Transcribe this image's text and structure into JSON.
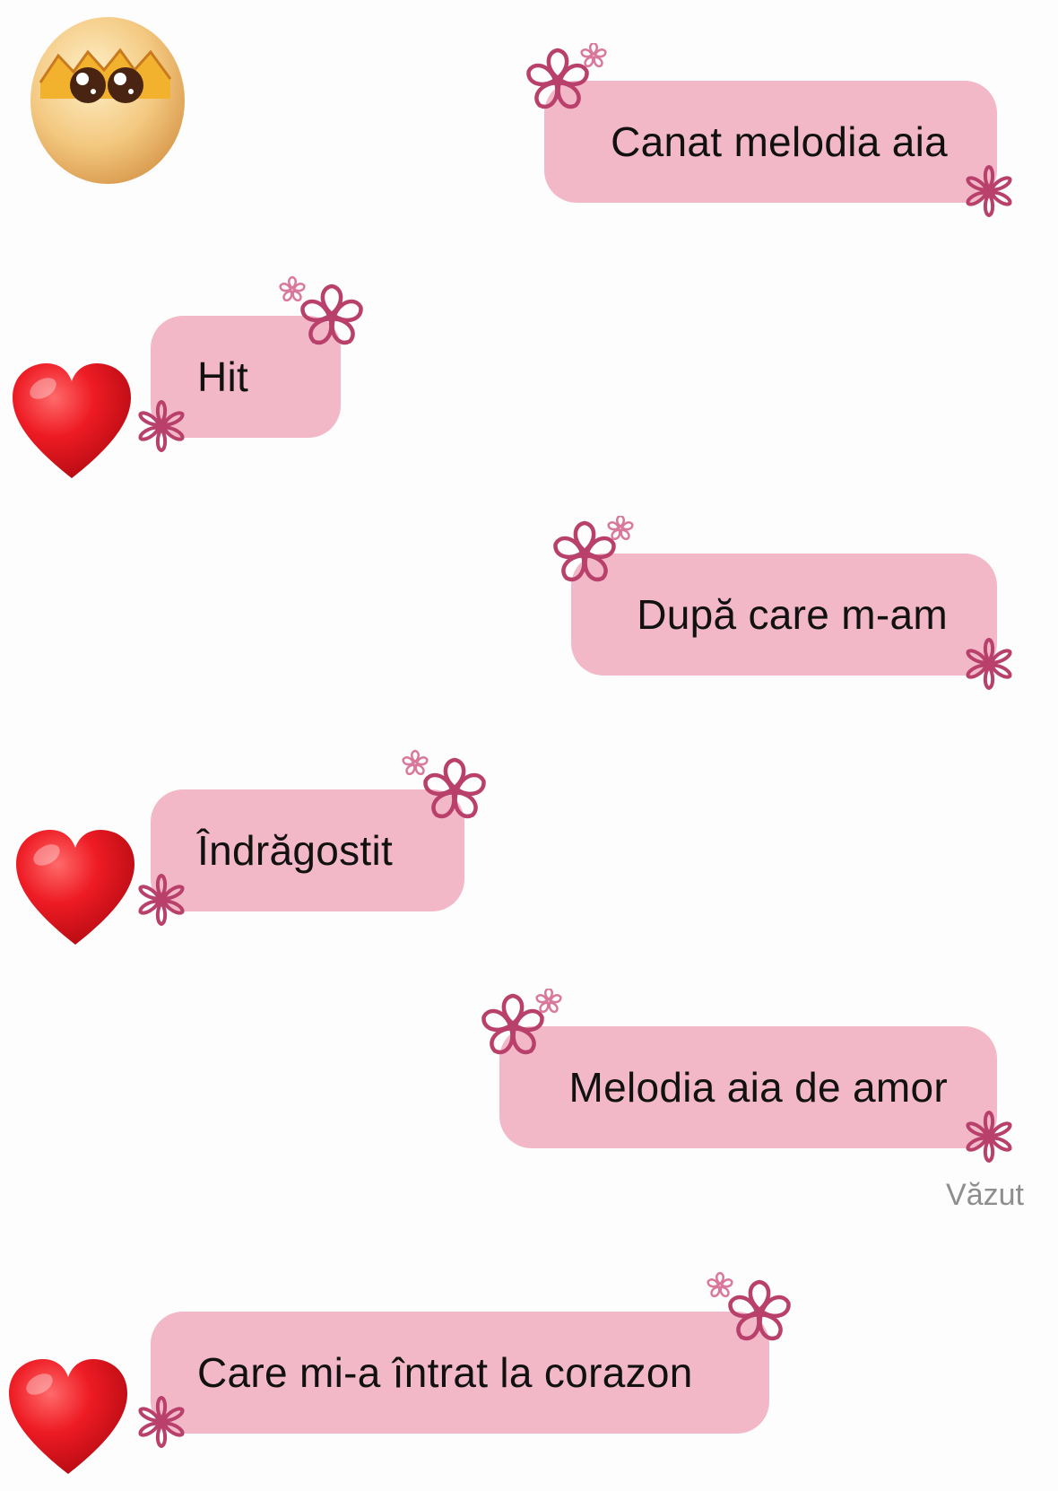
{
  "sticker": {
    "icon": "egg-chick-sticker-icon"
  },
  "messages": [
    {
      "id": "m1",
      "direction": "sent",
      "text": "Canat melodia aia"
    },
    {
      "id": "m2",
      "direction": "received",
      "text": "Hit",
      "reaction": "heart-icon"
    },
    {
      "id": "m3",
      "direction": "sent",
      "text": "După care m-am"
    },
    {
      "id": "m4",
      "direction": "received",
      "text": "Îndrăgostit",
      "reaction": "heart-icon"
    },
    {
      "id": "m5",
      "direction": "sent",
      "text": "Melodia aia de amor"
    },
    {
      "id": "m6",
      "direction": "received",
      "text": "Care mi-a întrat la corazon",
      "reaction": "heart-icon"
    }
  ],
  "status": {
    "seen_label": "Văzut"
  },
  "theme": {
    "bubble_color": "#f2b8c8",
    "flower_color": "#b8406a",
    "heart_color": "#e3121f",
    "background": "#fdfdfd"
  }
}
